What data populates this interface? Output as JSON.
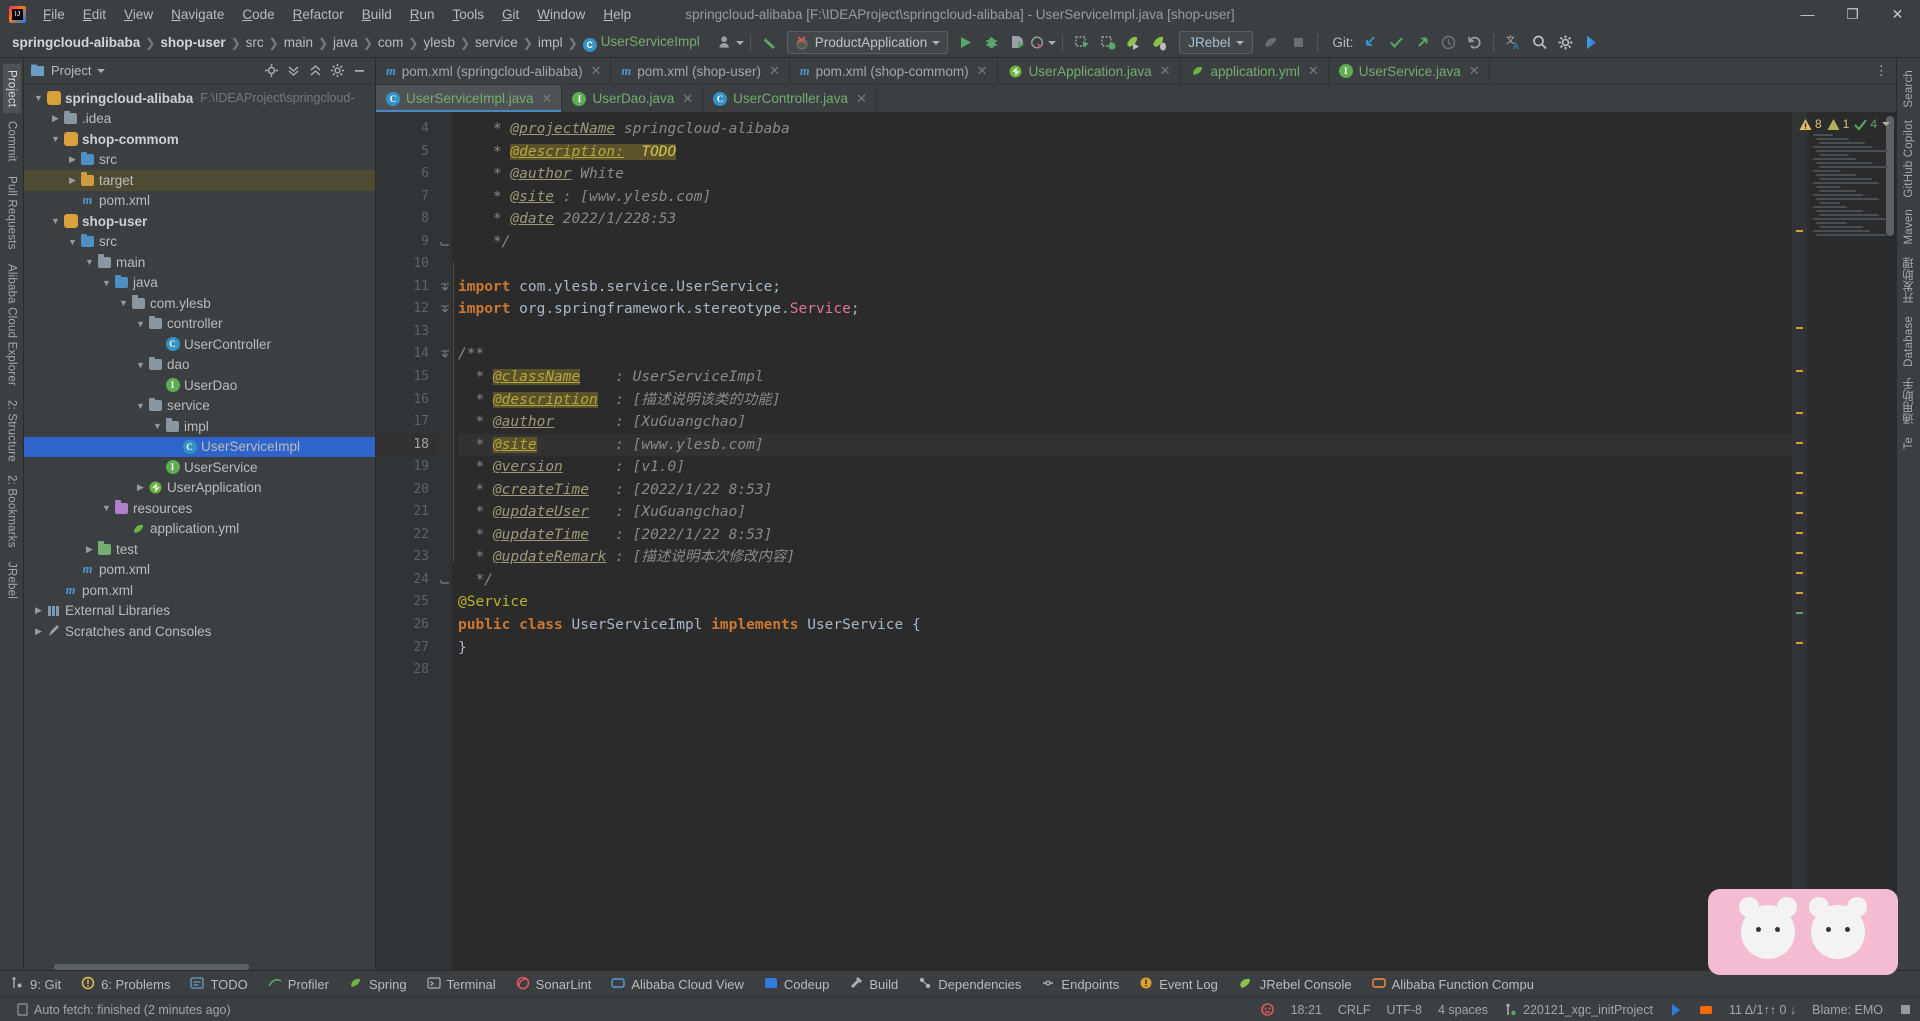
{
  "window": {
    "title": "springcloud-alibaba [F:\\IDEAProject\\springcloud-alibaba] - UserServiceImpl.java [shop-user]",
    "minimize": "—",
    "maximize": "❐",
    "close": "✕",
    "logo_text": "IJ"
  },
  "menu": [
    "File",
    "Edit",
    "View",
    "Navigate",
    "Code",
    "Refactor",
    "Build",
    "Run",
    "Tools",
    "Git",
    "Window",
    "Help"
  ],
  "breadcrumbs": [
    {
      "label": "springcloud-alibaba",
      "bold": true
    },
    {
      "label": "shop-user",
      "bold": true
    },
    {
      "label": "src",
      "bold": false
    },
    {
      "label": "main",
      "bold": false
    },
    {
      "label": "java",
      "bold": false
    },
    {
      "label": "com",
      "bold": false
    },
    {
      "label": "ylesb",
      "bold": false
    },
    {
      "label": "service",
      "bold": false
    },
    {
      "label": "impl",
      "bold": false
    },
    {
      "label": "UserServiceImpl",
      "bold": false,
      "icon": "C",
      "klass": true
    }
  ],
  "toolbar": {
    "run_config": "ProductApplication",
    "jrebel": "JRebel",
    "git_label": "Git:",
    "icons": {
      "profile": "profile-icon",
      "back_arrow": "back-arrow-icon",
      "run": "run-icon",
      "debug": "debug-icon",
      "run_coverage": "run-with-coverage-icon",
      "profiler": "profiler-icon",
      "more_run": "more-run-icon",
      "build": "build-icon",
      "build_alt": "build-module-icon",
      "jrebel_run": "jrebel-run-icon",
      "jrebel_debug": "jrebel-debug-icon",
      "rocket": "rocket-icon",
      "stop": "stop-icon",
      "update": "git-update-icon",
      "commit": "git-commit-icon",
      "push": "git-push-icon",
      "history": "git-history-icon",
      "rollback": "git-rollback-icon",
      "translate": "translate-icon",
      "search": "search-everywhere-icon",
      "settings": "settings-icon",
      "codegeex": "codegeex-icon"
    }
  },
  "left_stripe": [
    {
      "label": "Project",
      "selected": true
    },
    {
      "label": "Commit",
      "selected": false
    },
    {
      "label": "Pull Requests",
      "selected": false
    },
    {
      "label": "Alibaba Cloud Explorer",
      "selected": false
    },
    {
      "label": "2: Structure",
      "selected": false
    },
    {
      "label": "2: Bookmarks",
      "selected": false
    },
    {
      "label": "JRebel",
      "selected": false
    }
  ],
  "right_stripe": [
    {
      "label": "Search"
    },
    {
      "label": "GitHub Copilot"
    },
    {
      "label": "Maven"
    },
    {
      "label": "开发助理"
    },
    {
      "label": "Database"
    },
    {
      "label": "通用助手"
    },
    {
      "label": "Te"
    }
  ],
  "project_panel": {
    "title": "Project",
    "tree": [
      {
        "indent": 0,
        "arrow": "down",
        "icon": "module",
        "label": "springcloud-alibaba",
        "bold": true,
        "sub": "F:\\IDEAProject\\springcloud-"
      },
      {
        "indent": 1,
        "arrow": "right",
        "icon": "folder",
        "label": ".idea"
      },
      {
        "indent": 1,
        "arrow": "down",
        "icon": "module",
        "label": "shop-commom",
        "bold": true
      },
      {
        "indent": 2,
        "arrow": "right",
        "icon": "folder-src",
        "label": "src"
      },
      {
        "indent": 2,
        "arrow": "right",
        "icon": "folder-target",
        "label": "target",
        "highlight": true
      },
      {
        "indent": 2,
        "arrow": "none",
        "icon": "maven",
        "label": "pom.xml"
      },
      {
        "indent": 1,
        "arrow": "down",
        "icon": "module",
        "label": "shop-user",
        "bold": true
      },
      {
        "indent": 2,
        "arrow": "down",
        "icon": "folder-src",
        "label": "src"
      },
      {
        "indent": 3,
        "arrow": "down",
        "icon": "folder",
        "label": "main"
      },
      {
        "indent": 4,
        "arrow": "down",
        "icon": "folder-src",
        "label": "java"
      },
      {
        "indent": 5,
        "arrow": "down",
        "icon": "folder",
        "label": "com.ylesb"
      },
      {
        "indent": 6,
        "arrow": "down",
        "icon": "folder",
        "label": "controller"
      },
      {
        "indent": 7,
        "arrow": "none",
        "icon": "class",
        "label": "UserController"
      },
      {
        "indent": 6,
        "arrow": "down",
        "icon": "folder",
        "label": "dao"
      },
      {
        "indent": 7,
        "arrow": "none",
        "icon": "interface",
        "label": "UserDao"
      },
      {
        "indent": 6,
        "arrow": "down",
        "icon": "folder",
        "label": "service"
      },
      {
        "indent": 7,
        "arrow": "down",
        "icon": "folder",
        "label": "impl"
      },
      {
        "indent": 8,
        "arrow": "none",
        "icon": "class",
        "label": "UserServiceImpl",
        "selected": true
      },
      {
        "indent": 7,
        "arrow": "none",
        "icon": "interface",
        "label": "UserService"
      },
      {
        "indent": 6,
        "arrow": "right",
        "icon": "spring",
        "label": "UserApplication"
      },
      {
        "indent": 4,
        "arrow": "down",
        "icon": "folder-res",
        "label": "resources"
      },
      {
        "indent": 5,
        "arrow": "none",
        "icon": "yml",
        "label": "application.yml"
      },
      {
        "indent": 3,
        "arrow": "right",
        "icon": "folder-test",
        "label": "test"
      },
      {
        "indent": 2,
        "arrow": "none",
        "icon": "maven",
        "label": "pom.xml"
      },
      {
        "indent": 1,
        "arrow": "none",
        "icon": "maven",
        "label": "pom.xml"
      },
      {
        "indent": 0,
        "arrow": "right",
        "icon": "library",
        "label": "External Libraries"
      },
      {
        "indent": 0,
        "arrow": "right",
        "icon": "scratch",
        "label": "Scratches and Consoles"
      }
    ]
  },
  "editor": {
    "tabs_row1": [
      {
        "label": "pom.xml (springcloud-alibaba)",
        "icon": "maven",
        "active": false,
        "color": "grey"
      },
      {
        "label": "pom.xml (shop-user)",
        "icon": "maven",
        "active": false,
        "color": "blue"
      },
      {
        "label": "pom.xml (shop-commom)",
        "icon": "maven",
        "active": false,
        "color": "grey"
      },
      {
        "label": "UserApplication.java",
        "icon": "spring",
        "active": false,
        "color": "green"
      },
      {
        "label": "application.yml",
        "icon": "yml",
        "active": false,
        "color": "green"
      },
      {
        "label": "UserService.java",
        "icon": "interface",
        "active": false,
        "color": "green"
      }
    ],
    "tabs_row2": [
      {
        "label": "UserServiceImpl.java",
        "icon": "class",
        "active": true,
        "color": "green"
      },
      {
        "label": "UserDao.java",
        "icon": "interface",
        "active": false,
        "color": "green"
      },
      {
        "label": "UserController.java",
        "icon": "class",
        "active": false,
        "color": "green"
      }
    ],
    "inspection": {
      "warnings": "8",
      "weak_warnings": "1",
      "checks": "4"
    },
    "first_line_number": 4,
    "current_line": 18,
    "lines": [
      {
        "n": 4,
        "html": "    <span class='jdg'>* </span><span class='tagu'>@projectName</span><span class='jdg'> springcloud-alibaba</span>"
      },
      {
        "n": 5,
        "html": "    <span class='jdg'>* </span><span class='taghl'>@description:</span><span class='todo'>  TODO</span>"
      },
      {
        "n": 6,
        "html": "    <span class='jdg'>* </span><span class='tagu'>@author</span><span class='jdg'> White</span>"
      },
      {
        "n": 7,
        "html": "    <span class='jdg'>* </span><span class='tagu'>@site</span><span class='jdg'> : [www.ylesb.com]</span>"
      },
      {
        "n": 8,
        "html": "    <span class='jdg'>* </span><span class='tagu'>@date</span><span class='jdg'> 2022/1/228:53</span>"
      },
      {
        "n": 9,
        "html": "    <span class='jdg'>*/</span>"
      },
      {
        "n": 10,
        "html": ""
      },
      {
        "n": 11,
        "html": "<span class='kw'>import</span> <span class='pkg'>com.ylesb.service.</span><span class='pkg'>UserService</span><span class='pkg'>;</span>"
      },
      {
        "n": 12,
        "html": "<span class='kw'>import</span> <span class='pkg'>org.springframework.stereotype.</span><span class='imp'>Service</span><span class='pkg'>;</span>"
      },
      {
        "n": 13,
        "html": ""
      },
      {
        "n": 14,
        "html": "<span class='jdg'>/**</span>"
      },
      {
        "n": 15,
        "html": "  <span class='jdg'>* </span><span class='taghl'>@className</span><span class='jdg'>    : UserServiceImpl</span>"
      },
      {
        "n": 16,
        "html": "  <span class='jdg'>* </span><span class='taghl'>@description</span><span class='jdg'>  : [描述说明该类的功能]</span>"
      },
      {
        "n": 17,
        "html": "  <span class='jdg'>* </span><span class='tagu'>@author</span><span class='jdg'>       : [XuGuangchao]</span>"
      },
      {
        "n": 18,
        "html": "  <span class='jdg'>* </span><span class='taghl'>@site</span><span class='jdg'>         : [www.ylesb.com]</span>"
      },
      {
        "n": 19,
        "html": "  <span class='jdg'>* </span><span class='tagu'>@version</span><span class='jdg'>      : [v1.0]</span>"
      },
      {
        "n": 20,
        "html": "  <span class='jdg'>* </span><span class='tagu'>@createTime</span><span class='jdg'>   : [2022/1/22 8:53]</span>"
      },
      {
        "n": 21,
        "html": "  <span class='jdg'>* </span><span class='tagu'>@updateUser</span><span class='jdg'>   : [XuGuangchao]</span>"
      },
      {
        "n": 22,
        "html": "  <span class='jdg'>* </span><span class='tagu'>@updateTime</span><span class='jdg'>   : [2022/1/22 8:53]</span>"
      },
      {
        "n": 23,
        "html": "  <span class='jdg'>* </span><span class='tagu'>@updateRemark</span><span class='jdg'> : [描述说明本次修改内容]</span>"
      },
      {
        "n": 24,
        "html": "  <span class='jdg'>*/</span>"
      },
      {
        "n": 25,
        "html": "<span class='ann'>@Service</span>"
      },
      {
        "n": 26,
        "html": "<span class='kw'>public class </span><span class='cls'>UserServiceImpl </span><span class='kw'>implements </span><span class='cls'>UserService </span>{"
      },
      {
        "n": 27,
        "html": "}"
      },
      {
        "n": 28,
        "html": ""
      }
    ]
  },
  "bottom_tools": [
    {
      "label": "9: Git",
      "icon": "git-icon"
    },
    {
      "label": "6: Problems",
      "icon": "problems-icon"
    },
    {
      "label": "TODO",
      "icon": "todo-icon"
    },
    {
      "label": "Profiler",
      "icon": "profiler-icon"
    },
    {
      "label": "Spring",
      "icon": "spring-icon"
    },
    {
      "label": "Terminal",
      "icon": "terminal-icon"
    },
    {
      "label": "SonarLint",
      "icon": "sonarlint-icon"
    },
    {
      "label": "Alibaba Cloud View",
      "icon": "alibaba-cloud-icon"
    },
    {
      "label": "Codeup",
      "icon": "codeup-icon"
    },
    {
      "label": "Build",
      "icon": "build-icon"
    },
    {
      "label": "Dependencies",
      "icon": "dependencies-icon"
    },
    {
      "label": "Endpoints",
      "icon": "endpoints-icon"
    },
    {
      "label": "Event Log",
      "icon": "event-log-icon"
    },
    {
      "label": "JRebel Console",
      "icon": "jrebel-icon"
    },
    {
      "label": "Alibaba Function Compu",
      "icon": "alibaba-function-icon"
    }
  ],
  "statusbar": {
    "message": "Auto fetch: finished (2 minutes ago)",
    "time": "18:21",
    "line_sep": "CRLF",
    "encoding": "UTF-8",
    "indent": "4 spaces",
    "branch": "220121_xgc_initProject",
    "git_stats": "11 Δ/1↑↑ 0 ↓",
    "blame": "Blame: EMO",
    "notification": "■"
  }
}
